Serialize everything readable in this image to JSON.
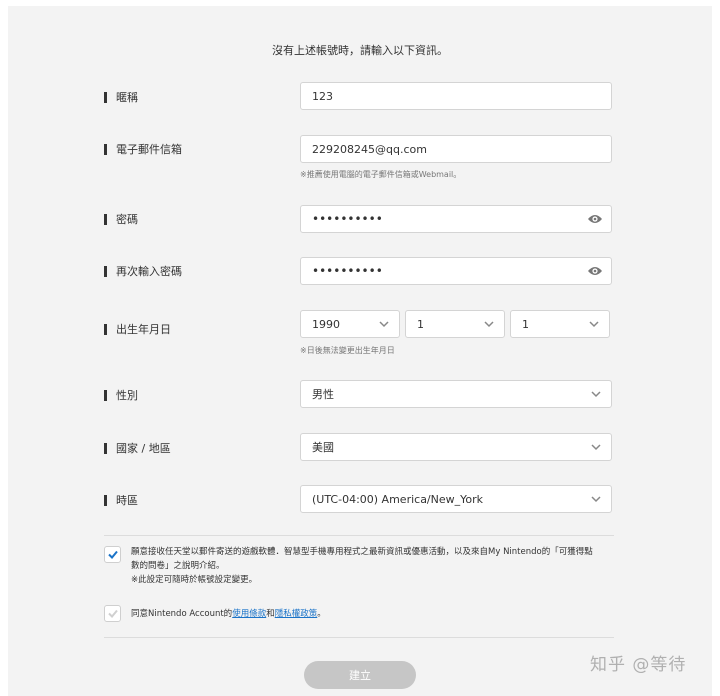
{
  "intro": "沒有上述帳號時，請輸入以下資訊。",
  "fields": {
    "nickname": {
      "label": "暱稱",
      "value": "123"
    },
    "email": {
      "label": "電子郵件信箱",
      "value": "229208245@qq.com",
      "hint": "※推薦使用電腦的電子郵件信箱或Webmail。"
    },
    "password": {
      "label": "密碼",
      "value": "••••••••••"
    },
    "password_confirm": {
      "label": "再次輸入密碼",
      "value": "••••••••••"
    },
    "birthday": {
      "label": "出生年月日",
      "year": "1990",
      "month": "1",
      "day": "1",
      "hint": "※日後無法變更出生年月日"
    },
    "gender": {
      "label": "性別",
      "value": "男性"
    },
    "country": {
      "label": "國家 / 地區",
      "value": "美國"
    },
    "timezone": {
      "label": "時區",
      "value": "(UTC-04:00) America/New_York"
    }
  },
  "consent": {
    "newsletter": {
      "checked": true,
      "line1": "願意接收任天堂以郵件寄送的遊戲軟體．智慧型手機專用程式之最新資訊或優惠活動，以及來自My Nintendo的「可獲得點",
      "line2": "數的問卷」之說明介紹。",
      "note": "※此設定可隨時於帳號設定變更。"
    },
    "terms": {
      "checked": false,
      "prefix": "同意Nintendo Account的",
      "link1": "使用條款",
      "mid": "和",
      "link2": "隱私權政策",
      "suffix": "。"
    }
  },
  "submit_label": "建立",
  "watermark": "知乎 @等待",
  "colors": {
    "panel_bg": "#f3f3f3",
    "check_blue": "#1a73c8",
    "button_disabled": "#c6c6c6"
  }
}
